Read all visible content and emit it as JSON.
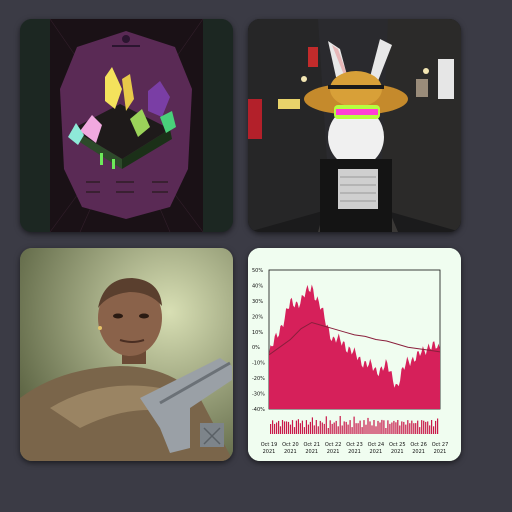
{
  "gallery": {
    "tiles": [
      {
        "subject": "crystal-island-artwork"
      },
      {
        "subject": "rabbit-in-sombrero-alley"
      },
      {
        "subject": "soldier-portrait"
      },
      {
        "subject": "price-chart"
      }
    ]
  },
  "chart_data": {
    "type": "area",
    "y_tick_labels": [
      "50%",
      "40%",
      "30%",
      "20%",
      "10%",
      "0%",
      "-10%",
      "-20%",
      "-30%",
      "-40%"
    ],
    "x_tick_labels": [
      [
        "Oct 19",
        "2021"
      ],
      [
        "Oct 20",
        "2021"
      ],
      [
        "Oct 21",
        "2021"
      ],
      [
        "Oct 22",
        "2021"
      ],
      [
        "Oct 23",
        "2021"
      ],
      [
        "Oct 24",
        "2021"
      ],
      [
        "Oct 25",
        "2021"
      ],
      [
        "Oct 26",
        "2021"
      ],
      [
        "Oct 27",
        "2021"
      ]
    ],
    "ylim": [
      -40,
      50
    ],
    "x": [
      "Oct 19",
      "Oct 19.5",
      "Oct 20",
      "Oct 20.5",
      "Oct 21",
      "Oct 21.5",
      "Oct 22",
      "Oct 22.5",
      "Oct 23",
      "Oct 23.5",
      "Oct 24",
      "Oct 24.5",
      "Oct 25",
      "Oct 25.5",
      "Oct 26",
      "Oct 26.5",
      "Oct 27"
    ],
    "series": [
      {
        "values": [
          -5,
          12,
          28,
          30,
          40,
          22,
          5,
          3,
          -5,
          -10,
          -15,
          -12,
          -25,
          -8,
          -6,
          2,
          -2
        ]
      },
      {
        "values": [
          -5,
          0,
          5,
          12,
          16,
          14,
          12,
          10,
          8,
          7,
          5,
          4,
          2,
          0,
          -1,
          -2,
          -3
        ]
      }
    ],
    "colors": {
      "area": "#d6205a",
      "trend": "#8a1f3c",
      "volume": "#c9184a",
      "background": "#f0fdf0"
    }
  }
}
